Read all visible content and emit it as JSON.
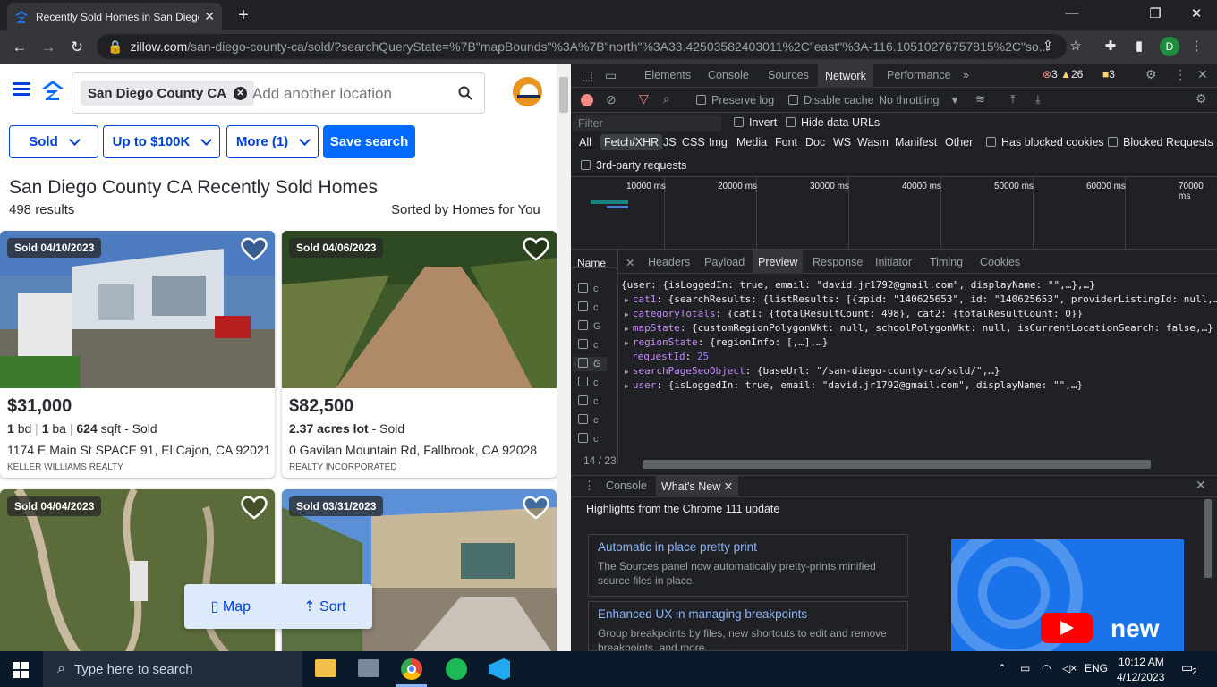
{
  "browser": {
    "tab_title": "Recently Sold Homes in San Diego",
    "url_host": "zillow.com",
    "url_path": "/san-diego-county-ca/sold/?searchQueryState=%7B\"mapBounds\"%3A%7B\"north\"%3A33.42503582403011%2C\"east\"%3A-116.10510276757815%2C\"so...",
    "profile_initial": "D"
  },
  "zillow": {
    "location_chip": "San Diego County CA",
    "search_placeholder": "Add another location",
    "filters": [
      "Sold",
      "Up to $100K",
      "More (1)"
    ],
    "save_search": "Save search",
    "title": "San Diego County CA Recently Sold Homes",
    "results": "498 results",
    "sorted_by": "Sorted by Homes for You",
    "listings": [
      {
        "badge": "Sold 04/10/2023",
        "price": "$31,000",
        "bd": "1",
        "bd_label": "bd",
        "ba": "1",
        "ba_label": "ba",
        "sqft": "624",
        "sqft_label": "sqft - Sold",
        "address": "1174 E Main St SPACE 91, El Cajon, CA 92021",
        "broker": "KELLER WILLIAMS REALTY"
      },
      {
        "badge": "Sold 04/06/2023",
        "price": "$82,500",
        "lot": "2.37 acres lot",
        "lot_suffix": "- Sold",
        "address": "0 Gavilan Mountain Rd, Fallbrook, CA 92028",
        "broker": "REALTY INCORPORATED"
      },
      {
        "badge": "Sold 04/04/2023"
      },
      {
        "badge": "Sold 03/31/2023"
      }
    ],
    "map_button": "Map",
    "sort_button": "Sort"
  },
  "devtools": {
    "tabs": [
      "Elements",
      "Console",
      "Sources",
      "Network",
      "Performance"
    ],
    "active_tab": "Network",
    "errors": "3",
    "warnings": "26",
    "issues": "3",
    "preserve_log": "Preserve log",
    "disable_cache": "Disable cache",
    "throttling": "No throttling",
    "filter_placeholder": "Filter",
    "invert": "Invert",
    "hide_data_urls": "Hide data URLs",
    "type_filters": [
      "All",
      "Fetch/XHR",
      "JS",
      "CSS",
      "Img",
      "Media",
      "Font",
      "Doc",
      "WS",
      "Wasm",
      "Manifest",
      "Other"
    ],
    "has_blocked_cookies": "Has blocked cookies",
    "blocked_requests": "Blocked Requests",
    "third_party": "3rd-party requests",
    "timeline_ticks": [
      "10000 ms",
      "20000 ms",
      "30000 ms",
      "40000 ms",
      "50000 ms",
      "60000 ms",
      "70000 ms"
    ],
    "name_header": "Name",
    "detail_tabs": [
      "Headers",
      "Payload",
      "Preview",
      "Response",
      "Initiator",
      "Timing",
      "Cookies"
    ],
    "active_detail_tab": "Preview",
    "name_cells": [
      "c",
      "c",
      "G",
      "c",
      "c",
      "G",
      "c",
      "c",
      "c",
      "c"
    ],
    "request_count": "14 / 23",
    "preview_lines": [
      {
        "key": "",
        "text": "{user: {isLoggedIn: true, email: \"david.jr1792@gmail.com\", displayName: \"\",…},…}"
      },
      {
        "key": "cat1",
        "text": ": {searchResults: {listResults: [{zpid: \"140625653\", id: \"140625653\", providerListingId: null,…"
      },
      {
        "key": "categoryTotals",
        "text": ": {cat1: {totalResultCount: 498}, cat2: {totalResultCount: 0}}"
      },
      {
        "key": "mapState",
        "text": ": {customRegionPolygonWkt: null, schoolPolygonWkt: null, isCurrentLocationSearch: false,…}"
      },
      {
        "key": "regionState",
        "text": ": {regionInfo: [,…],…}"
      },
      {
        "key": "requestId",
        "text": "25"
      },
      {
        "key": "searchPageSeoObject",
        "text": ": {baseUrl: \"/san-diego-county-ca/sold/\",…}"
      },
      {
        "key": "user",
        "text": ": {isLoggedIn: true, email: \"david.jr1792@gmail.com\", displayName: \"\",…}"
      }
    ],
    "drawer_tabs": [
      "Console",
      "What's New"
    ],
    "whatsnew_heading": "Highlights from the Chrome 111 update",
    "whatsnew_items": [
      {
        "title": "Automatic in place pretty print",
        "body": "The Sources panel now automatically pretty-prints minified source files in place."
      },
      {
        "title": "Enhanced UX in managing breakpoints",
        "body": "Group breakpoints by files, new shortcuts to edit and remove breakpoints, and more."
      }
    ],
    "video_text": "new"
  },
  "taskbar": {
    "search_placeholder": "Type here to search",
    "language": "ENG",
    "time": "10:12 AM",
    "date": "4/12/2023",
    "notifications": "2"
  }
}
